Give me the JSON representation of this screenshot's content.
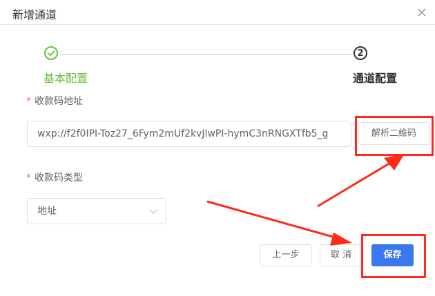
{
  "dialog": {
    "title": "新增通道"
  },
  "steps": [
    {
      "label": "基本配置",
      "status": "finished",
      "color": "#67c23a"
    },
    {
      "number": "2",
      "label": "通道配置",
      "status": "active"
    }
  ],
  "form": {
    "address_label": "收款码地址",
    "address_value": "wxp://f2f0IPI-Toz27_6Fym2mUf2kvJlwPI-hymC3nRNGXTfb5_g",
    "parse_button": "解析二维码",
    "type_label": "收款码类型",
    "type_value": "地址",
    "required_mark": "*"
  },
  "footer": {
    "prev_label": "上一步",
    "cancel_label": "取 消",
    "save_label": "保存"
  },
  "colors": {
    "primary": "#3a78ee",
    "success": "#67c23a",
    "annotation": "#ff2a1a",
    "required": "#f56c6c"
  },
  "icons": {
    "close": "close-icon",
    "check": "check-icon",
    "dropdown": "chevron-down-icon"
  }
}
